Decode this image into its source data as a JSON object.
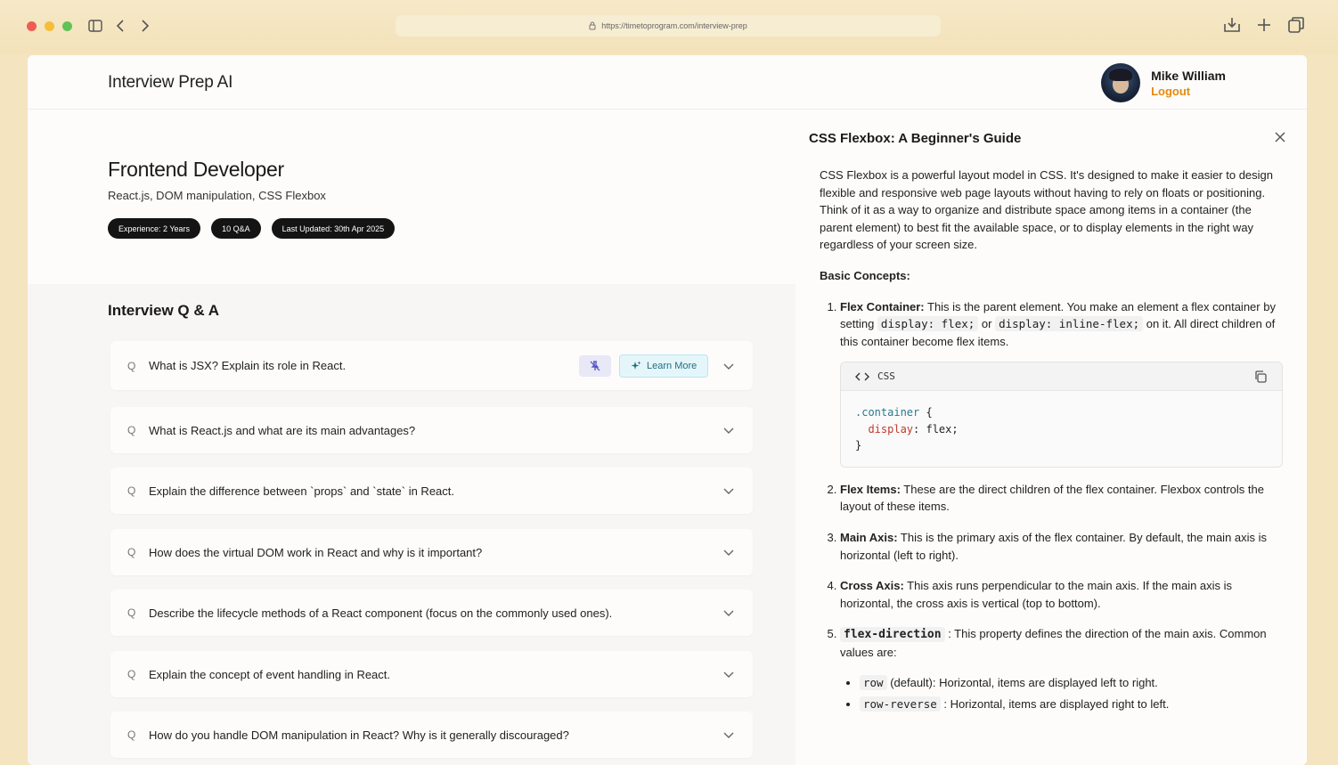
{
  "browser": {
    "url": "https://timetoprogram.com/interview-prep"
  },
  "header": {
    "brand": "Interview Prep AI",
    "user_name": "Mike William",
    "logout_label": "Logout"
  },
  "session": {
    "role": "Frontend Developer",
    "topics": "React.js, DOM manipulation, CSS Flexbox",
    "badges": [
      "Experience: 2 Years",
      "10 Q&A",
      "Last Updated: 30th Apr 2025"
    ]
  },
  "qa": {
    "title": "Interview Q & A",
    "q_marker": "Q",
    "learn_more_label": "Learn More",
    "questions": [
      "What is JSX? Explain its role in React.",
      "What is React.js and what are its main advantages?",
      "Explain the difference between `props` and `state` in React.",
      "How does the virtual DOM work in React and why is it important?",
      "Describe the lifecycle methods of a React component (focus on the commonly used ones).",
      "Explain the concept of event handling in React.",
      "How do you handle DOM manipulation in React? Why is it generally discouraged?"
    ]
  },
  "panel": {
    "title": "CSS Flexbox: A Beginner's Guide",
    "intro": "CSS Flexbox is a powerful layout model in CSS. It's designed to make it easier to design flexible and responsive web page layouts without having to rely on floats or positioning. Think of it as a way to organize and distribute space among items in a container (the parent element) to best fit the available space, or to display elements in the right way regardless of your screen size.",
    "basic_heading": "Basic Concepts:",
    "c1_title": "Flex Container:",
    "c1_a": " This is the parent element. You make an element a flex container by setting ",
    "c1_code1": "display: flex;",
    "c1_b": " or ",
    "c1_code2": "display: inline-flex;",
    "c1_c": " on it. All direct children of this container become flex items.",
    "code_lang": "CSS",
    "code_selector": ".container",
    "code_open": " {",
    "code_prop": "display",
    "code_value": ": flex;",
    "code_close": "}",
    "c2_title": "Flex Items:",
    "c2_text": " These are the direct children of the flex container. Flexbox controls the layout of these items.",
    "c3_title": "Main Axis:",
    "c3_text": " This is the primary axis of the flex container. By default, the main axis is horizontal (left to right).",
    "c4_title": "Cross Axis:",
    "c4_text": " This axis runs perpendicular to the main axis. If the main axis is horizontal, the cross axis is vertical (top to bottom).",
    "c5_code": "flex-direction",
    "c5_text": " : This property defines the direction of the main axis. Common values are:",
    "v1_code": "row",
    "v1_text": " (default): Horizontal, items are displayed left to right.",
    "v2_code": "row-reverse",
    "v2_text": " : Horizontal, items are displayed right to left."
  }
}
